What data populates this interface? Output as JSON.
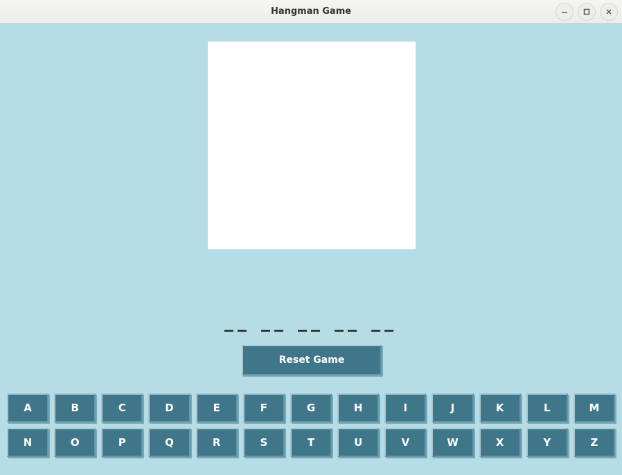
{
  "window": {
    "title": "Hangman Game"
  },
  "game": {
    "word_display": "__ __ __ __ __",
    "reset_label": "Reset Game",
    "letters_row1": [
      "A",
      "B",
      "C",
      "D",
      "E",
      "F",
      "G",
      "H",
      "I",
      "J",
      "K",
      "L",
      "M"
    ],
    "letters_row2": [
      "N",
      "O",
      "P",
      "Q",
      "R",
      "S",
      "T",
      "U",
      "V",
      "W",
      "X",
      "Y",
      "Z"
    ]
  },
  "colors": {
    "bg": "#b6dde6",
    "button": "#40768a",
    "button_text": "#ffffff",
    "canvas": "#ffffff"
  }
}
